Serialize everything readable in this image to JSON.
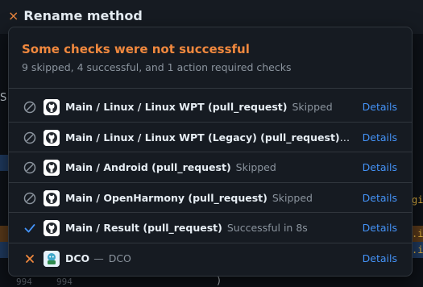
{
  "header": {
    "close_glyph": "×",
    "title": "Rename method"
  },
  "background": {
    "letter": "S",
    "right_snippets": [
      "gin",
      ".in",
      ".in"
    ],
    "line_numbers": [
      "994",
      "994"
    ],
    "paren": ")"
  },
  "popup": {
    "title": "Some checks were not successful",
    "subtitle": "9 skipped, 4 successful, and 1 action required checks",
    "title_color": "#f0883e",
    "link_color": "#4493f8",
    "checks": [
      {
        "status": "skipped",
        "name": "Main / Linux / Linux WPT (pull_request)",
        "desc": "Skipped",
        "avatar": "github-icon",
        "link": "Details"
      },
      {
        "status": "skipped",
        "name": "Main / Linux / Linux WPT (Legacy) (pull_request)",
        "desc": "S...",
        "avatar": "github-icon",
        "link": "Details"
      },
      {
        "status": "skipped",
        "name": "Main / Android (pull_request)",
        "desc": "Skipped",
        "avatar": "github-icon",
        "link": "Details"
      },
      {
        "status": "skipped",
        "name": "Main / OpenHarmony (pull_request)",
        "desc": "Skipped",
        "avatar": "github-icon",
        "link": "Details"
      },
      {
        "status": "success",
        "name": "Main / Result (pull_request)",
        "desc": "Successful in 8s",
        "avatar": "github-icon",
        "link": "Details"
      },
      {
        "status": "action_required",
        "name": "DCO",
        "dash": "—",
        "desc": "DCO",
        "avatar": "dco-icon",
        "link": "Details"
      }
    ]
  }
}
